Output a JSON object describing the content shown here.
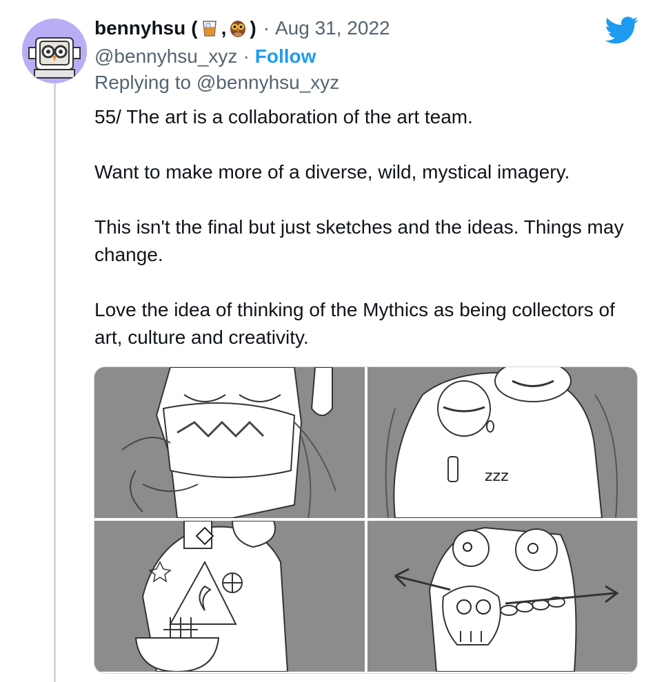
{
  "tweet": {
    "display_name": "bennyhsu",
    "name_open": "(",
    "name_comma": ",",
    "name_close": ")",
    "separator": "·",
    "date": "Aug 31, 2022",
    "handle": "@bennyhsu_xyz",
    "follow_label": "Follow",
    "reply_prefix": "Replying to",
    "reply_handle": "@bennyhsu_xyz",
    "paragraphs": [
      "55/ The art is a collaboration of the art team.",
      "Want to make more of a diverse, wild, mystical imagery.",
      "This isn't the final but just sketches and the ideas. Things may change.",
      "Love the idea of thinking of the Mythics as being collectors of art, culture and creativity."
    ],
    "sketch_text": "zzz"
  },
  "colors": {
    "accent": "#1d9bf0",
    "text": "#0f1419",
    "secondary": "#536471",
    "avatar_bg": "#b9aef5",
    "sketch_bg": "#8c8c8c"
  },
  "icons": [
    "avatar-owl",
    "whiskey-glass-emoji",
    "owl-emoji",
    "twitter-bird-icon"
  ]
}
